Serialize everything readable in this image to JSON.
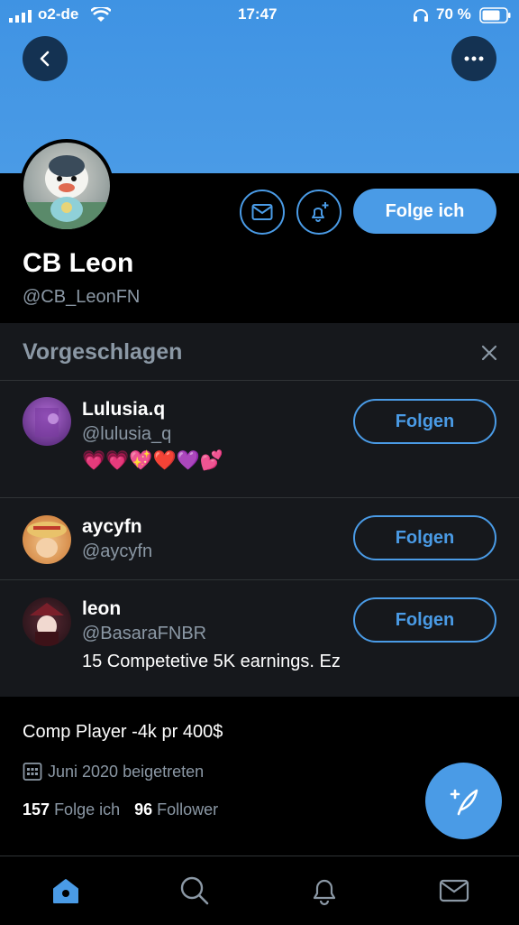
{
  "status_bar": {
    "carrier": "o2-de",
    "time": "17:47",
    "battery": "70 %"
  },
  "profile": {
    "name": "CB Leon",
    "handle": "@CB_LeonFN",
    "follow_button": "Folge ich",
    "bio": "Comp Player -4k pr 400$",
    "joined": "Juni 2020 beigetreten",
    "following_count": "157",
    "following_label": "Folge ich",
    "followers_count": "96",
    "followers_label": "Follower"
  },
  "suggested": {
    "title": "Vorgeschlagen",
    "items": [
      {
        "name": "Lulusia.q",
        "handle": "@lulusia_q",
        "bio": "💗💗💖❤️💜💕",
        "button": "Folgen"
      },
      {
        "name": "aycyfn",
        "handle": "@aycyfn",
        "bio": "",
        "button": "Folgen"
      },
      {
        "name": "leon",
        "handle": "@BasaraFNBR",
        "bio": "15 Competetive 5K earnings. Ez",
        "button": "Folgen"
      }
    ]
  },
  "colors": {
    "accent": "#4a9be6",
    "banner": "#4a9be6",
    "panel": "#16181c",
    "muted": "#8b98a5"
  },
  "icons": [
    "back-icon",
    "more-icon",
    "mail-icon",
    "bell-plus-icon",
    "close-icon",
    "calendar-icon",
    "compose-icon",
    "home-icon",
    "search-icon",
    "bell-icon",
    "messages-icon"
  ]
}
